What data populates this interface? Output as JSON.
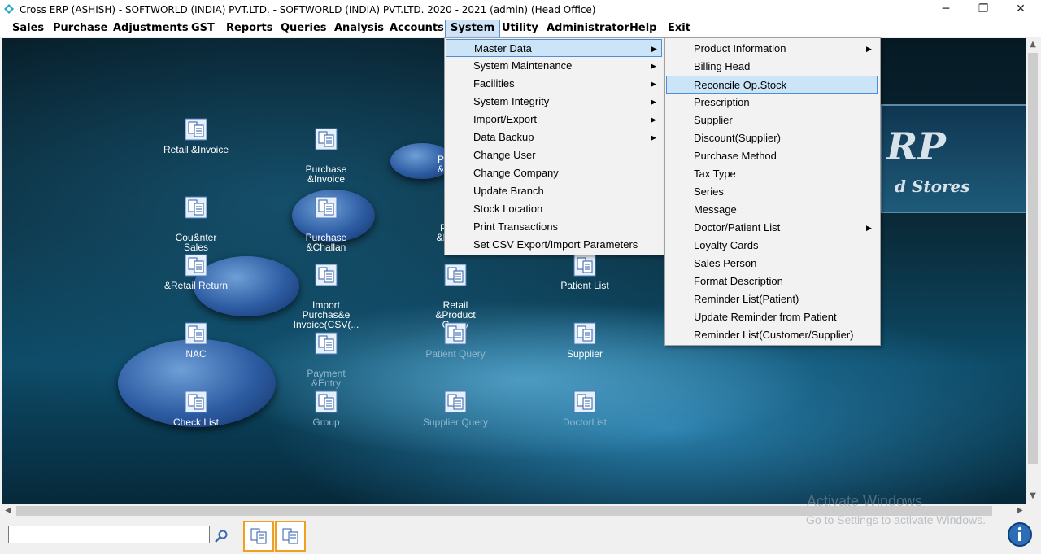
{
  "window": {
    "title": "Cross ERP (ASHISH) - SOFTWORLD (INDIA) PVT.LTD. - SOFTWORLD (INDIA) PVT.LTD.  2020 - 2021 (admin) (Head Office)",
    "minimize": "─",
    "restore": "❐",
    "close": "✕"
  },
  "menubar": [
    "Sales",
    "Purchase",
    "Adjustments",
    "GST",
    "Reports",
    "Queries",
    "Analysis",
    "Accounts",
    "System",
    "Utility",
    "Administrator",
    "Help",
    "Exit"
  ],
  "active_menu": "System",
  "system_menu": {
    "items": [
      {
        "label": "Master Data",
        "submenu": true
      },
      {
        "label": "System Maintenance",
        "submenu": true
      },
      {
        "label": "Facilities",
        "submenu": true
      },
      {
        "label": "System Integrity",
        "submenu": true
      },
      {
        "label": "Import/Export",
        "submenu": true
      },
      {
        "label": "Data Backup",
        "submenu": true
      },
      {
        "label": "Change User",
        "submenu": false
      },
      {
        "label": "Change Company",
        "submenu": false
      },
      {
        "label": "Update Branch",
        "submenu": false
      },
      {
        "label": "Stock Location",
        "submenu": false
      },
      {
        "label": "Print Transactions",
        "submenu": false
      },
      {
        "label": "Set CSV Export/Import Parameters",
        "submenu": false
      }
    ]
  },
  "master_data_menu": {
    "items": [
      {
        "label": "Product Information",
        "submenu": true
      },
      {
        "label": "Billing Head",
        "submenu": false
      },
      {
        "label": "Reconcile Op.Stock",
        "submenu": false
      },
      {
        "label": "Prescription",
        "submenu": false
      },
      {
        "label": "Supplier",
        "submenu": false
      },
      {
        "label": "Discount(Supplier)",
        "submenu": false
      },
      {
        "label": "Purchase Method",
        "submenu": false
      },
      {
        "label": "Tax Type",
        "submenu": false
      },
      {
        "label": "Series",
        "submenu": false
      },
      {
        "label": "Message",
        "submenu": false
      },
      {
        "label": "Doctor/Patient List",
        "submenu": true
      },
      {
        "label": "Loyalty Cards",
        "submenu": false
      },
      {
        "label": "Sales Person",
        "submenu": false
      },
      {
        "label": "Format Description",
        "submenu": false
      },
      {
        "label": "Reminder List(Patient)",
        "submenu": false
      },
      {
        "label": "Update Reminder from Patient",
        "submenu": false
      },
      {
        "label": "Reminder List(Customer/Supplier)",
        "submenu": false
      }
    ]
  },
  "highlighted": {
    "system_menu": "Master Data",
    "master_data_menu": "Reconcile Op.Stock"
  },
  "logo": {
    "big": "RP",
    "sub": "d Stores"
  },
  "shortcuts": [
    {
      "label": "Retail &Invoice",
      "icon": "document-icon"
    },
    {
      "label": "Purchase\n&Invoice",
      "icon": "document-icon"
    },
    {
      "label": "P\n&",
      "icon": "document-icon"
    },
    {
      "label": "Cou&nter\nSales",
      "icon": "document-icon"
    },
    {
      "label": "Purchase\n&Challan",
      "icon": "document-icon"
    },
    {
      "label": "P\n&D",
      "icon": "document-icon"
    },
    {
      "label": "&Retail Return",
      "icon": "document-icon"
    },
    {
      "label": "Import\nPurchas&e\nInvoice(CSV(...",
      "icon": "document-icon"
    },
    {
      "label": "Retail\n&Product\nQuery",
      "icon": "document-icon"
    },
    {
      "label": "Patient List",
      "icon": "document-icon"
    },
    {
      "label": "NAC",
      "icon": "document-icon"
    },
    {
      "label": "Payment\n&Entry",
      "icon": "document-icon"
    },
    {
      "label": "Patient Query",
      "icon": "document-icon"
    },
    {
      "label": "Supplier",
      "icon": "document-icon"
    },
    {
      "label": "Check List",
      "icon": "document-icon"
    },
    {
      "label": "Group",
      "icon": "document-icon"
    },
    {
      "label": "Supplier Query",
      "icon": "document-icon"
    },
    {
      "label": "DoctorList",
      "icon": "document-icon"
    }
  ],
  "search": {
    "value": "",
    "icon": "magnifier-icon"
  },
  "watermark": {
    "line1": "Activate Windows",
    "line2": "Go to Settings to activate Windows."
  },
  "colors": {
    "menu_highlight": "#cce4f7",
    "menu_highlight_border": "#4d8fd6",
    "taskbar_button_border": "#f0a020"
  }
}
